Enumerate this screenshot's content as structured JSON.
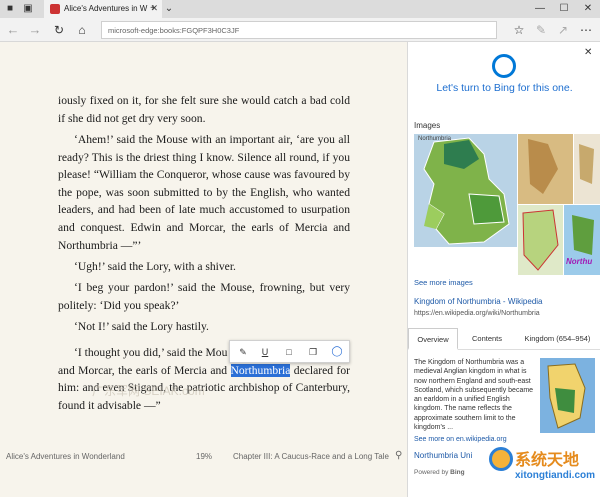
{
  "browser": {
    "tab_title": "Alice's Adventures in W",
    "address": "microsoft-edge:books:FGQPF3H0C3JF"
  },
  "book": {
    "paragraphs": [
      "iously fixed on it, for she felt sure she would catch a bad cold if she did not get dry very soon.",
      "‘Ahem!’ said the Mouse with an important air, ‘are you all ready? This is the driest thing I know. Silence all round, if you please! “William the Conqueror, whose cause was favoured by the pope, was soon submitted to by the English, who wanted leaders, and had been of late much accustomed to usurpation and conquest. Edwin and Morcar, the earls of Mercia and Northumbria —”’",
      "‘Ugh!’ said the Lory, with a shiver.",
      "‘I beg your pardon!’ said the Mouse, frowning, but very politely: ‘Did you speak?’",
      "‘Not I!’ said the Lory hastily."
    ],
    "last_paragraph": {
      "line1": "‘I thought you did,’ said the Mou",
      "line2_before": "and Morcar, the earls of Mercia and ",
      "highlight": "Northumbria",
      "line2_after": " declared for",
      "rest": "him: and even Stigand, the patriotic archbishop of Canterbury, found it advisable —”"
    },
    "footer": {
      "title": "Alice's Adventures in Wonderland",
      "progress": "19%",
      "chapter": "Chapter III: A Caucus-Race and a Long Tale"
    }
  },
  "panel": {
    "bing_text": "Let's turn to Bing for this one.",
    "images_label": "Images",
    "see_more_images": "See more images",
    "result_title": "Kingdom of Northumbria - Wikipedia",
    "result_url": "https://en.wikipedia.org/wiki/Northumbria",
    "tabs": [
      "Overview",
      "Contents",
      "Kingdom (654–954)"
    ],
    "description": "The Kingdom of Northumbria was a medieval Anglian kingdom in what is now northern England and south-east Scotland, which subsequently became an earldom in a unified English kingdom. The name reflects the approximate southern limit to the kingdom's ...",
    "see_more": "See more on en.wikipedia.org",
    "next_link": "Northumbria Uni",
    "map_label": "Northu",
    "powered_by": "Powered by",
    "bing": "Bing"
  },
  "watermarks": {
    "left": "广东军网 SEIAK.com",
    "right": "系统天地",
    "right_url": "xitongtiandi.com"
  },
  "colors": {
    "accent": "#2b6fd6",
    "link": "#1e5aa8",
    "bing_blue": "#0078d7"
  }
}
